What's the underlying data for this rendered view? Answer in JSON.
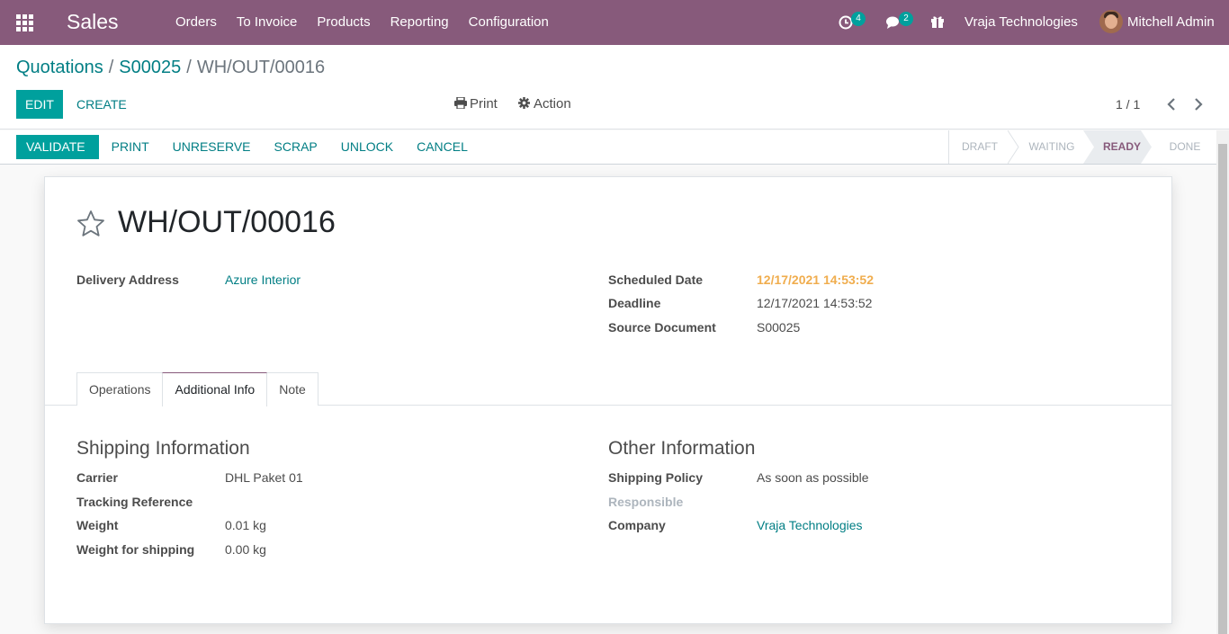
{
  "app": {
    "name": "Sales",
    "menu": [
      "Orders",
      "To Invoice",
      "Products",
      "Reporting",
      "Configuration"
    ],
    "activity_count": "4",
    "messages_count": "2",
    "company": "Vraja Technologies",
    "user": "Mitchell Admin"
  },
  "breadcrumb": {
    "level1": "Quotations",
    "level2": "S00025",
    "current": "WH/OUT/00016"
  },
  "control_panel": {
    "edit": "Edit",
    "create": "Create",
    "print": "Print",
    "action": "Action",
    "pager": "1 / 1"
  },
  "statusbar": {
    "buttons": [
      "Validate",
      "Print",
      "Unreserve",
      "Scrap",
      "Unlock",
      "Cancel"
    ],
    "stages": [
      "Draft",
      "Waiting",
      "Ready",
      "Done"
    ],
    "current_stage": "Ready"
  },
  "record": {
    "name": "WH/OUT/00016",
    "delivery_address_label": "Delivery Address",
    "delivery_address": "Azure Interior",
    "scheduled_date_label": "Scheduled Date",
    "scheduled_date": "12/17/2021 14:53:52",
    "deadline_label": "Deadline",
    "deadline": "12/17/2021 14:53:52",
    "source_document_label": "Source Document",
    "source_document": "S00025"
  },
  "tabs": [
    "Operations",
    "Additional Info",
    "Note"
  ],
  "active_tab": "Additional Info",
  "shipping": {
    "title": "Shipping Information",
    "carrier_label": "Carrier",
    "carrier": "DHL Paket 01",
    "tracking_label": "Tracking Reference",
    "tracking": "",
    "weight_label": "Weight",
    "weight": "0.01",
    "weight_unit": "kg",
    "shipping_weight_label": "Weight for shipping",
    "shipping_weight": "0.00",
    "shipping_weight_unit": "kg"
  },
  "other": {
    "title": "Other Information",
    "policy_label": "Shipping Policy",
    "policy": "As soon as possible",
    "responsible_label": "Responsible",
    "responsible": "",
    "company_label": "Company",
    "company": "Vraja Technologies"
  },
  "colors": {
    "navbar": "#875a7b",
    "primary": "#00a09d",
    "link": "#017e84",
    "warning": "#f0ad4e"
  },
  "icons": [
    "apps-grid-icon",
    "activity-clock-icon",
    "chat-icon",
    "gift-icon",
    "printer-icon",
    "gear-icon",
    "chevron-left-icon",
    "chevron-right-icon",
    "star-icon"
  ]
}
